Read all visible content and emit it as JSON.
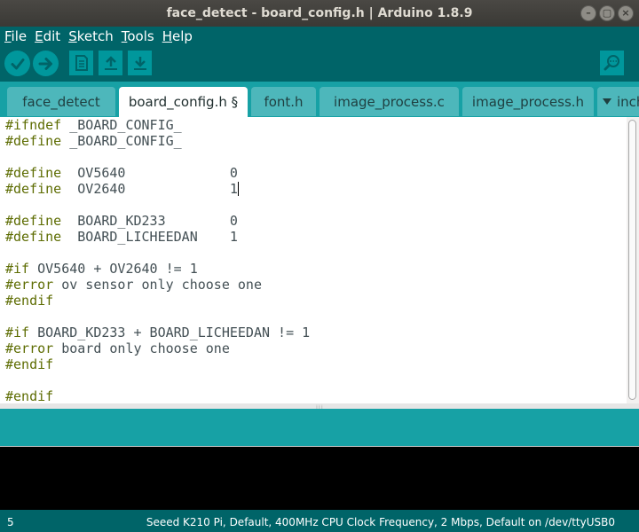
{
  "window": {
    "title": "face_detect - board_config.h | Arduino 1.8.9",
    "buttons": [
      "–",
      "▢",
      "×"
    ]
  },
  "menu": {
    "items": [
      {
        "mnemonic": "F",
        "rest": "ile"
      },
      {
        "mnemonic": "E",
        "rest": "dit"
      },
      {
        "mnemonic": "S",
        "rest": "ketch"
      },
      {
        "mnemonic": "T",
        "rest": "ools"
      },
      {
        "mnemonic": "H",
        "rest": "elp"
      }
    ]
  },
  "toolbar": {
    "icons": [
      "verify-icon",
      "upload-icon",
      "new-icon",
      "open-icon",
      "save-icon",
      "serial-monitor-icon"
    ],
    "colors": {
      "button": "#00979c",
      "glyph": "#006468",
      "background": "#006468"
    }
  },
  "tabs": [
    {
      "label": "face_detect",
      "active": false
    },
    {
      "label": "board_config.h §",
      "active": true
    },
    {
      "label": "font.h",
      "active": false
    },
    {
      "label": "image_process.c",
      "active": false
    },
    {
      "label": "image_process.h",
      "active": false
    }
  ],
  "tab_overflow": {
    "label": "inch",
    "icon": "tab-menu-arrow-icon"
  },
  "editor": {
    "lines": [
      {
        "kw": "#ifndef",
        "text": " _BOARD_CONFIG_"
      },
      {
        "kw": "#define",
        "text": " _BOARD_CONFIG_"
      },
      {
        "kw": "",
        "text": ""
      },
      {
        "kw": "#define",
        "text": "  OV5640             0"
      },
      {
        "kw": "#define",
        "text": "  OV2640             1"
      },
      {
        "kw": "",
        "text": ""
      },
      {
        "kw": "#define",
        "text": "  BOARD_KD233        0"
      },
      {
        "kw": "#define",
        "text": "  BOARD_LICHEEDAN    1"
      },
      {
        "kw": "",
        "text": ""
      },
      {
        "kw": "#if",
        "text": " OV5640 + OV2640 != 1"
      },
      {
        "kw": "#error",
        "text": " ov sensor only choose one"
      },
      {
        "kw": "#endif",
        "text": ""
      },
      {
        "kw": "",
        "text": ""
      },
      {
        "kw": "#if",
        "text": " BOARD_KD233 + BOARD_LICHEEDAN != 1"
      },
      {
        "kw": "#error",
        "text": " board only choose one"
      },
      {
        "kw": "#endif",
        "text": ""
      },
      {
        "kw": "",
        "text": ""
      },
      {
        "kw": "#endif",
        "text": ""
      }
    ],
    "caret_line": 4,
    "colors": {
      "keyword": "#5e6d03",
      "text": "#434f54"
    }
  },
  "status": {
    "line_number": "5",
    "board_info": "Seeed K210 Pi, Default, 400MHz CPU Clock Frequency, 2 Mbps, Default on /dev/ttyUSB0"
  }
}
